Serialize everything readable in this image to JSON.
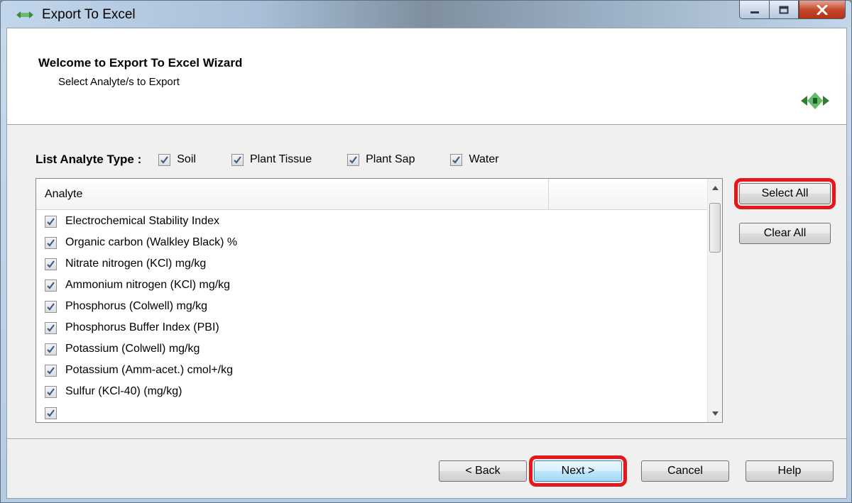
{
  "window": {
    "title": "Export To Excel"
  },
  "wizard": {
    "title": "Welcome to Export To Excel Wizard",
    "subtitle": "Select Analyte/s to Export"
  },
  "analyte_types": {
    "label": "List Analyte Type :",
    "options": [
      {
        "label": "Soil",
        "checked": true
      },
      {
        "label": "Plant Tissue",
        "checked": true
      },
      {
        "label": "Plant Sap",
        "checked": true
      },
      {
        "label": "Water",
        "checked": true
      }
    ]
  },
  "list": {
    "column_header": "Analyte",
    "rows": [
      {
        "label": "Electrochemical Stability Index",
        "checked": true
      },
      {
        "label": "Organic carbon (Walkley Black) %",
        "checked": true
      },
      {
        "label": "Nitrate nitrogen (KCl) mg/kg",
        "checked": true
      },
      {
        "label": "Ammonium nitrogen (KCl) mg/kg",
        "checked": true
      },
      {
        "label": "Phosphorus (Colwell) mg/kg",
        "checked": true
      },
      {
        "label": "Phosphorus Buffer Index (PBI)",
        "checked": true
      },
      {
        "label": "Potassium (Colwell) mg/kg",
        "checked": true
      },
      {
        "label": "Potassium (Amm-acet.) cmol+/kg",
        "checked": true
      },
      {
        "label": "Sulfur (KCl-40) (mg/kg)",
        "checked": true
      }
    ]
  },
  "buttons": {
    "select_all": "Select All",
    "clear_all": "Clear All",
    "back": "< Back",
    "next": "Next >",
    "cancel": "Cancel",
    "help": "Help"
  },
  "colors": {
    "highlight": "#e4181c",
    "check": "#3a5a8a"
  }
}
